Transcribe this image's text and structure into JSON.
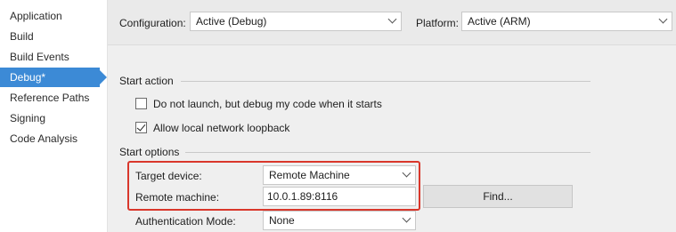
{
  "sidebar": {
    "items": [
      {
        "label": "Application",
        "active": false
      },
      {
        "label": "Build",
        "active": false
      },
      {
        "label": "Build Events",
        "active": false
      },
      {
        "label": "Debug*",
        "active": true
      },
      {
        "label": "Reference Paths",
        "active": false
      },
      {
        "label": "Signing",
        "active": false
      },
      {
        "label": "Code Analysis",
        "active": false
      }
    ]
  },
  "header": {
    "configuration_label": "Configuration:",
    "configuration_value": "Active (Debug)",
    "platform_label": "Platform:",
    "platform_value": "Active (ARM)"
  },
  "start_action": {
    "title": "Start action",
    "options": [
      {
        "label": "Do not launch, but debug my code when it starts",
        "checked": false
      },
      {
        "label": "Allow local network loopback",
        "checked": true
      }
    ]
  },
  "start_options": {
    "title": "Start options",
    "target_device_label": "Target device:",
    "target_device_value": "Remote Machine",
    "remote_machine_label": "Remote machine:",
    "remote_machine_value": "10.0.1.89:8116",
    "find_button_label": "Find...",
    "auth_mode_label": "Authentication Mode:",
    "auth_mode_value": "None"
  },
  "colors": {
    "accent": "#3c8ad6",
    "highlight": "#d9372b"
  }
}
